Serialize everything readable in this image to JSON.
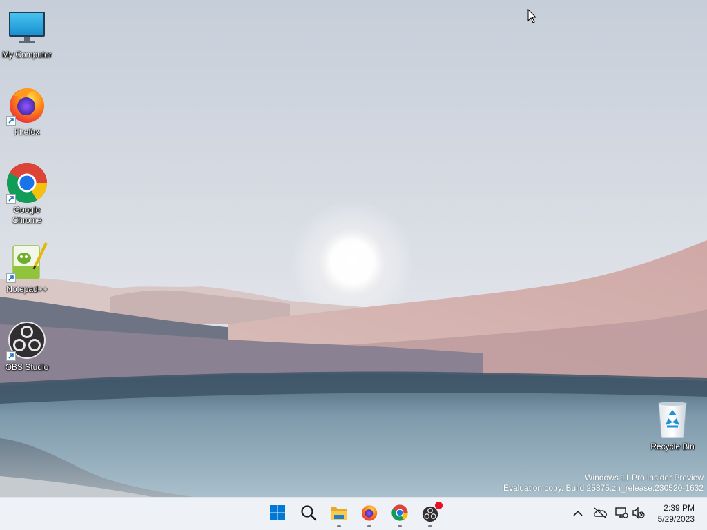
{
  "desktop": {
    "icons": [
      {
        "label": "My Computer",
        "icon": "monitor-icon"
      },
      {
        "label": "Firefox",
        "icon": "firefox-icon"
      },
      {
        "label": "Google Chrome",
        "icon": "chrome-icon"
      },
      {
        "label": "Notepad++",
        "icon": "notepadpp-icon"
      },
      {
        "label": "OBS Studio",
        "icon": "obs-icon"
      },
      {
        "label": "Recycle Bin",
        "icon": "recycle-bin-icon"
      }
    ],
    "watermark": {
      "line1": "Windows 11 Pro Insider Preview",
      "line2": "Evaluation copy. Build 25375.zn_release.230520-1632"
    }
  },
  "taskbar": {
    "apps": [
      {
        "name": "Start",
        "icon": "windows-start-icon",
        "running": false
      },
      {
        "name": "Search",
        "icon": "search-icon",
        "running": false
      },
      {
        "name": "File Explorer",
        "icon": "folder-icon",
        "running": true
      },
      {
        "name": "Firefox",
        "icon": "firefox-icon",
        "running": true
      },
      {
        "name": "Google Chrome",
        "icon": "chrome-icon",
        "running": true
      },
      {
        "name": "OBS Studio",
        "icon": "obs-icon",
        "running": true,
        "recording": true
      }
    ],
    "tray": {
      "icons": [
        "chevron-up-icon",
        "onedrive-offline-icon",
        "network-icon",
        "volume-muted-icon"
      ]
    },
    "clock": {
      "time": "2:39 PM",
      "date": "5/29/2023"
    }
  },
  "colors": {
    "taskbar_bg": "#eef1f6",
    "accent": "#0067c0",
    "recording_dot": "#e81123"
  }
}
